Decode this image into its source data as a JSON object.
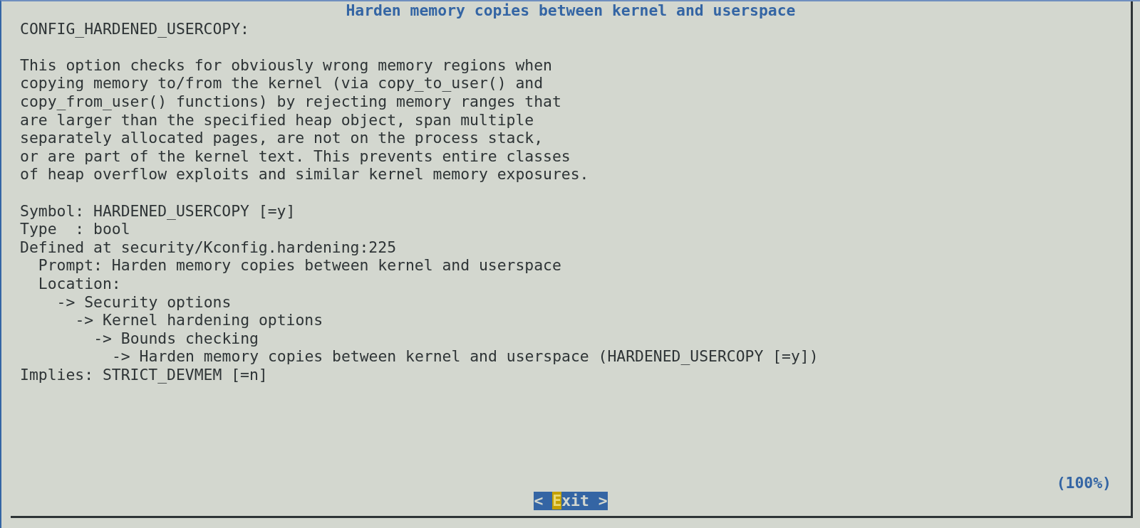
{
  "title": "Harden memory copies between kernel and userspace",
  "config_name": "CONFIG_HARDENED_USERCOPY:",
  "description": [
    "This option checks for obviously wrong memory regions when",
    "copying memory to/from the kernel (via copy_to_user() and",
    "copy_from_user() functions) by rejecting memory ranges that",
    "are larger than the specified heap object, span multiple",
    "separately allocated pages, are not on the process stack,",
    "or are part of the kernel text. This prevents entire classes",
    "of heap overflow exploits and similar kernel memory exposures."
  ],
  "details": [
    {
      "text": "Symbol: HARDENED_USERCOPY [=y]"
    },
    {
      "text": "Type  : bool"
    },
    {
      "text": "Defined at security/Kconfig.hardening:225",
      "children": [
        {
          "text": "Prompt: Harden memory copies between kernel and userspace"
        },
        {
          "text": "Location:",
          "children": [
            {
              "text": "-> Security options",
              "children": [
                {
                  "text": "-> Kernel hardening options",
                  "children": [
                    {
                      "text": "-> Bounds checking",
                      "children": [
                        {
                          "text": "-> Harden memory copies between kernel and userspace (HARDENED_USERCOPY [=y])"
                        }
                      ]
                    }
                  ]
                }
              ]
            }
          ]
        }
      ]
    },
    {
      "text": "Implies: STRICT_DEVMEM [=n]"
    }
  ],
  "scroll_position": "(100%)",
  "exit_button": {
    "prefix": "< ",
    "hotkey": "E",
    "suffix": "xit >",
    "selected": true
  }
}
